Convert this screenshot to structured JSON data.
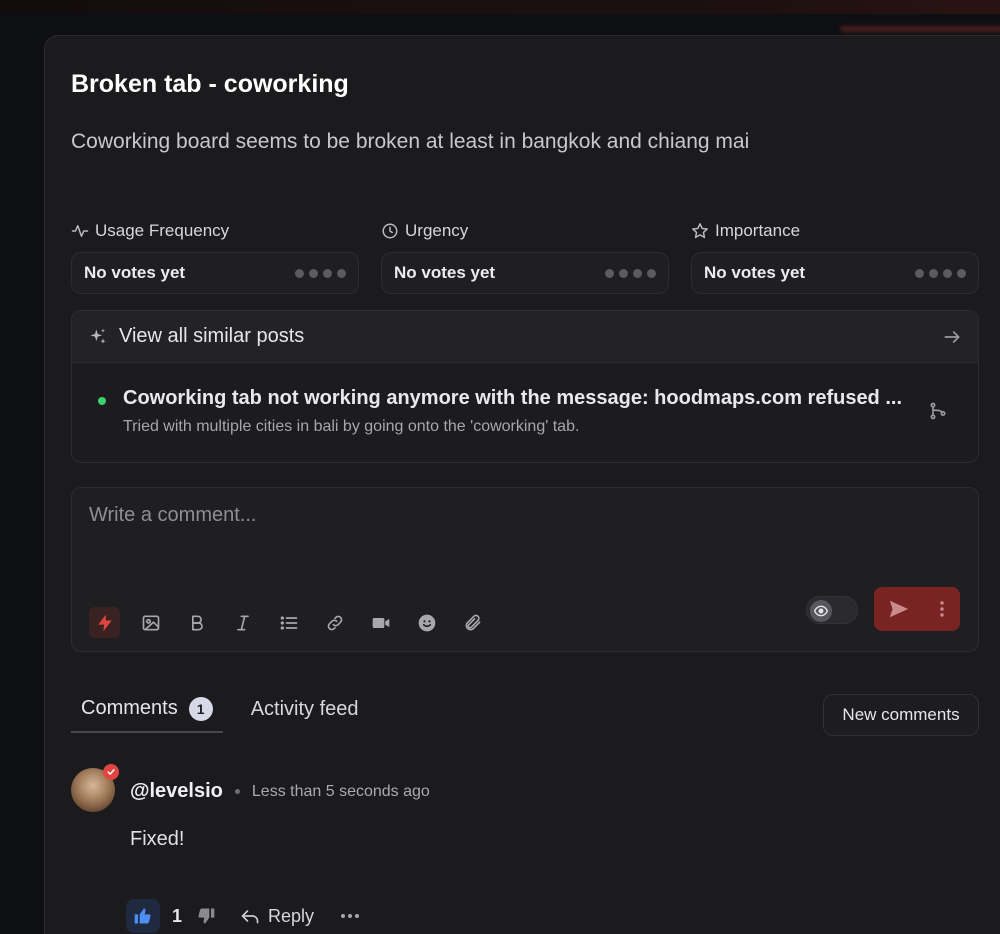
{
  "post": {
    "title": "Broken tab - coworking",
    "description": "Coworking board seems to be broken at least in bangkok and chiang mai"
  },
  "metrics": [
    {
      "title": "Usage Frequency",
      "value": "No votes yet",
      "icon": "activity-icon"
    },
    {
      "title": "Urgency",
      "value": "No votes yet",
      "icon": "clock-icon"
    },
    {
      "title": "Importance",
      "value": "No votes yet",
      "icon": "star-icon"
    }
  ],
  "similar": {
    "header": "View all similar posts",
    "item_title": "Coworking tab not working anymore with the message: hoodmaps.com refused ...",
    "item_subtitle": "Tried with multiple cities in bali by going onto the 'coworking' tab.",
    "status_color": "#3ecf6e"
  },
  "composer": {
    "placeholder": "Write a comment...",
    "toolbar_icons": [
      "bolt-icon",
      "image-icon",
      "bold-icon",
      "italic-icon",
      "list-icon",
      "link-icon",
      "video-icon",
      "emoji-icon",
      "attachment-icon"
    ],
    "accent": "#e0463f"
  },
  "tabs": {
    "comments_label": "Comments",
    "comments_count": "1",
    "activity_label": "Activity feed"
  },
  "new_comments_label": "New comments",
  "comment": {
    "username": "@levelsio",
    "timestamp": "Less than 5 seconds ago",
    "text": "Fixed!",
    "like_count": "1",
    "reply_label": "Reply"
  }
}
